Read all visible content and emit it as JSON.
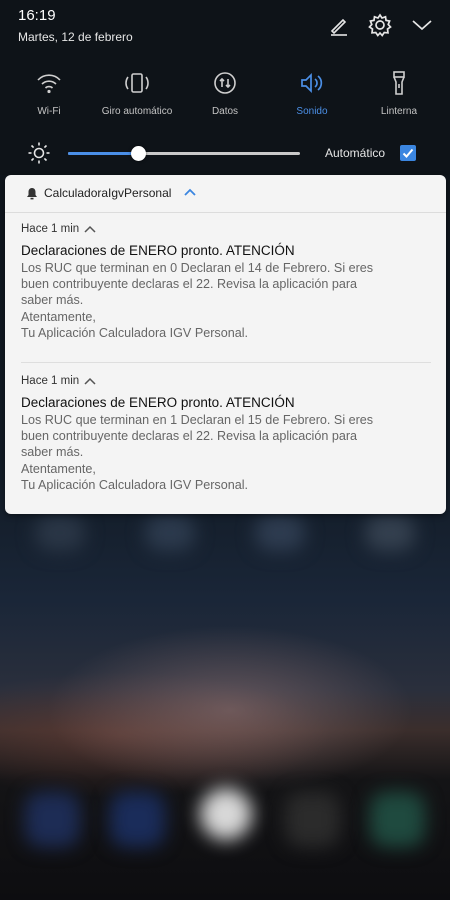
{
  "status_bar": {
    "time": "16:19",
    "date": "Martes, 12 de febrero",
    "icons": [
      "edit-icon",
      "gear-icon",
      "chevron-down-icon"
    ]
  },
  "quick_settings": {
    "toggles": [
      {
        "label": "Wi-Fi",
        "icon": "wifi-icon",
        "active": false
      },
      {
        "label": "Giro automático",
        "icon": "rotate-icon",
        "active": false
      },
      {
        "label": "Datos",
        "icon": "data-icon",
        "active": false
      },
      {
        "label": "Sonido",
        "icon": "sound-icon",
        "active": true
      },
      {
        "label": "Linterna",
        "icon": "flashlight-icon",
        "active": false
      }
    ],
    "brightness": {
      "level": 0.3,
      "auto_label": "Automático",
      "auto_checked": true
    },
    "accent_color": "#4a8fe8"
  },
  "notification_group": {
    "app_name": "CalculadoraIgvPersonal",
    "notifications": [
      {
        "time": "Hace 1 min",
        "title": "Declaraciones de ENERO pronto. ATENCIÓN",
        "body_lines": [
          "Los RUC que terminan en 0 Declaran el 14 de Febrero. Si eres",
          "buen contribuyente declaras el 22. Revisa la aplicación para",
          "saber más.",
          "Atentamente,",
          "Tu Aplicación Calculadora IGV Personal."
        ]
      },
      {
        "time": "Hace 1 min",
        "title": "Declaraciones de ENERO pronto. ATENCIÓN",
        "body_lines": [
          "Los RUC que terminan en 1 Declaran el 15 de Febrero. Si eres",
          "buen contribuyente declaras el 22. Revisa la aplicación para",
          "saber más.",
          "Atentamente,",
          "Tu Aplicación Calculadora IGV Personal."
        ]
      }
    ]
  }
}
